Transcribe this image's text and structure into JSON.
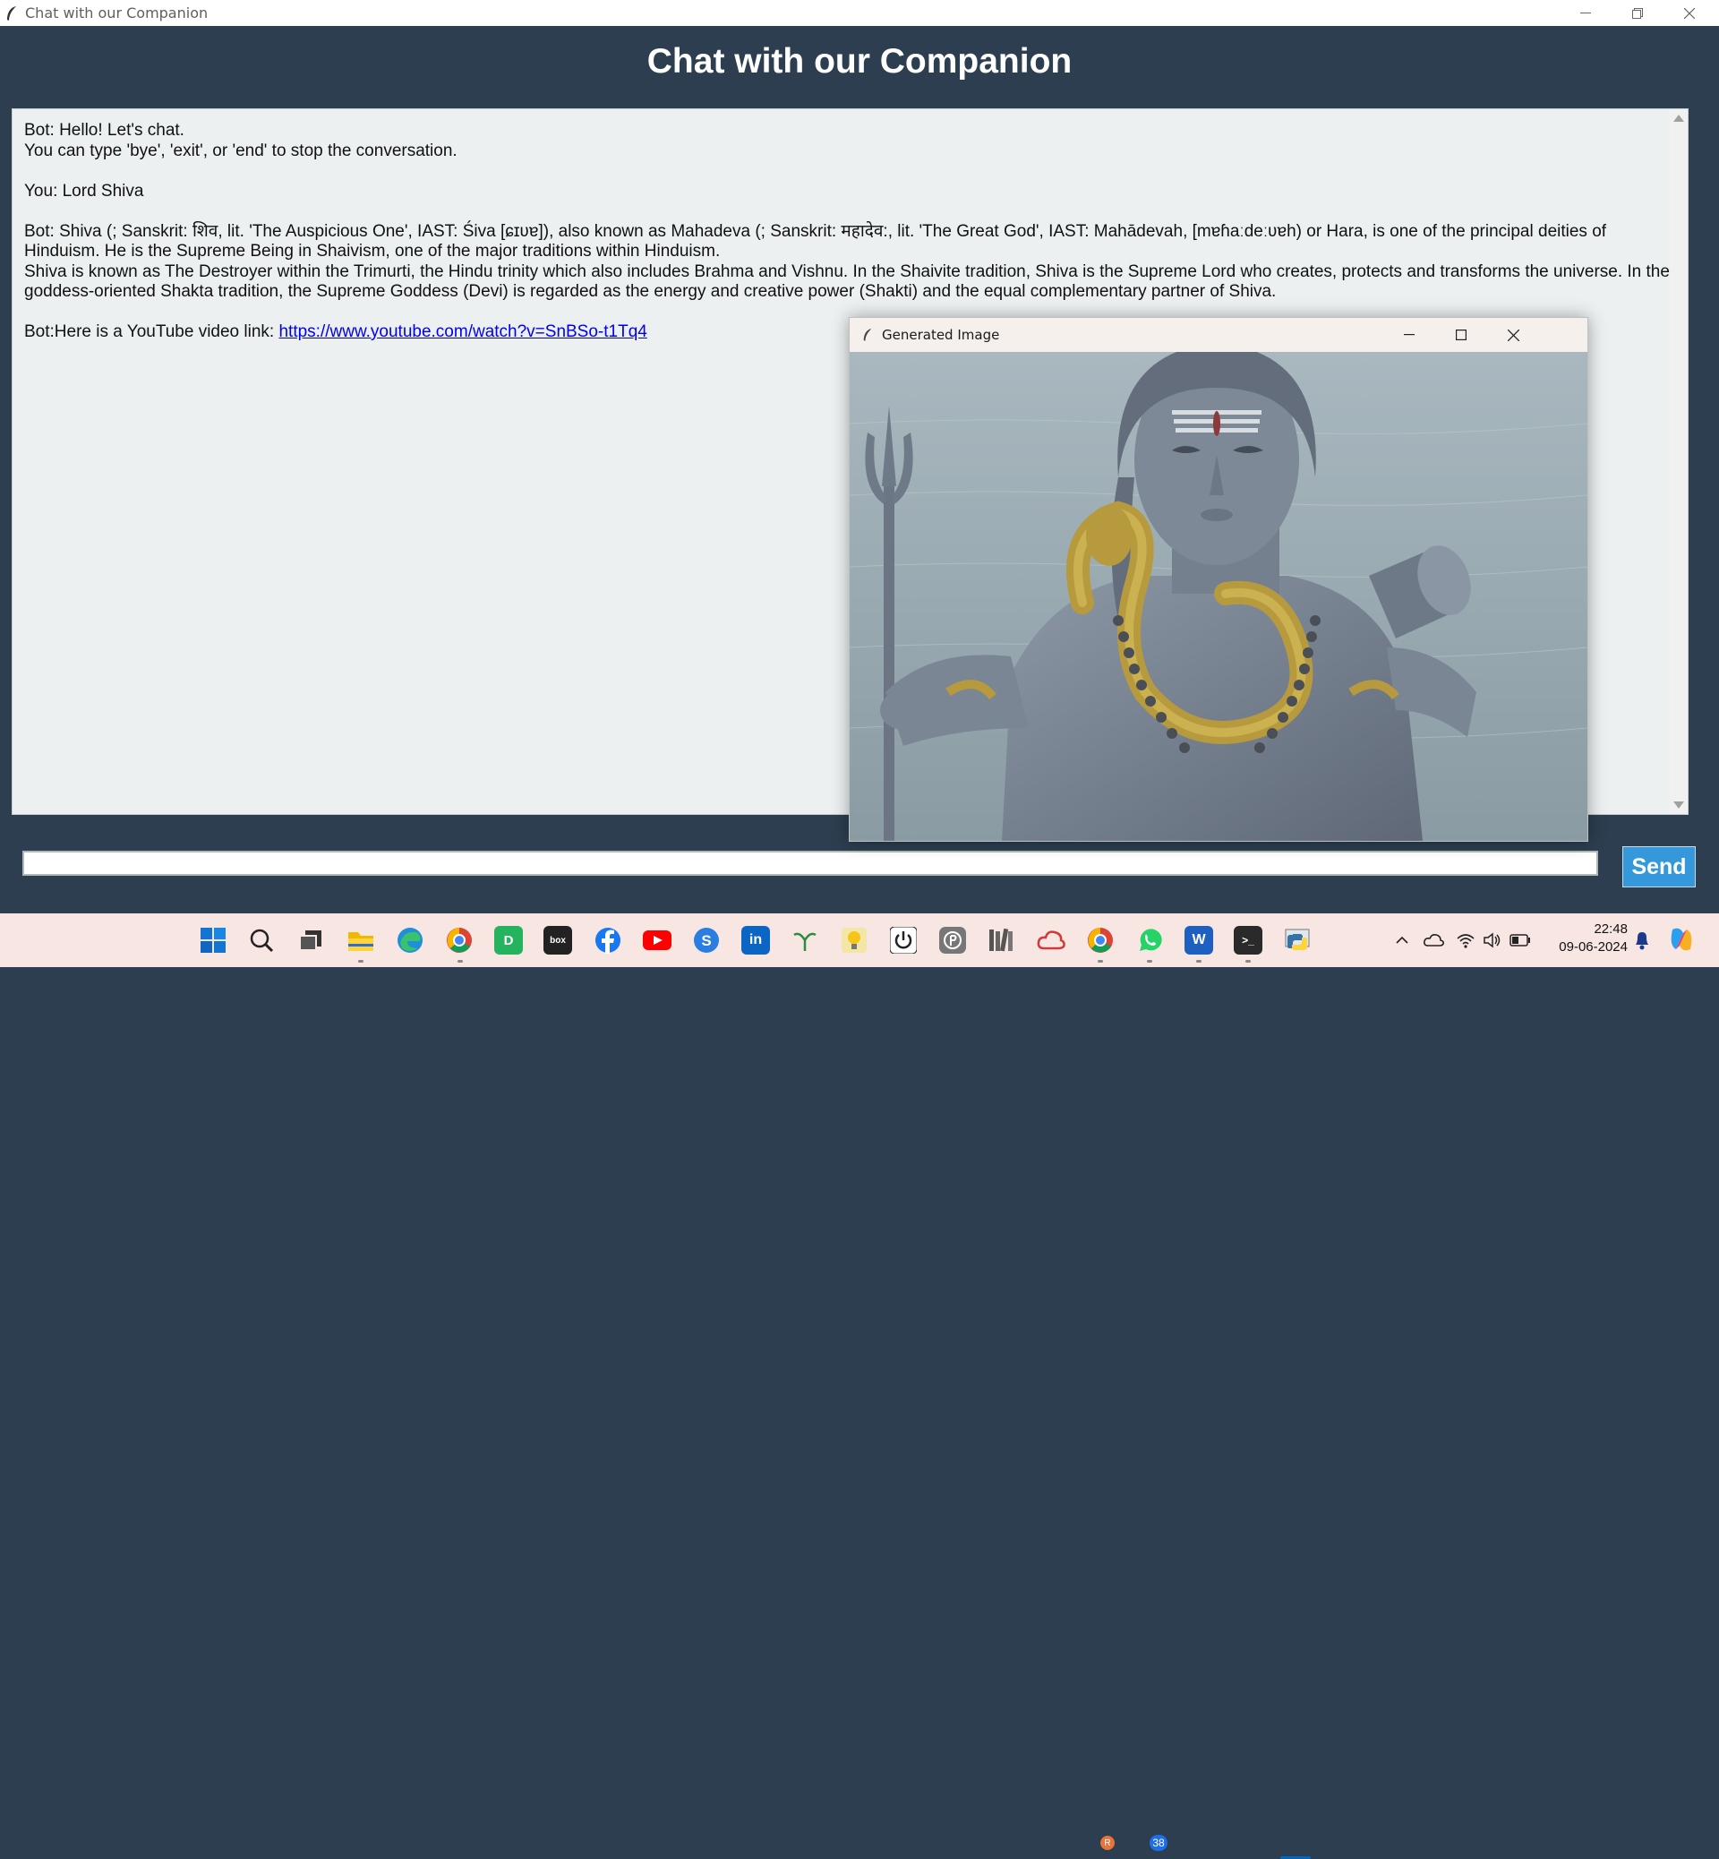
{
  "window": {
    "title": "Chat with our Companion"
  },
  "header": {
    "title": "Chat with our Companion"
  },
  "chat": {
    "greeting": "Bot: Hello! Let's chat.",
    "instructions": "You can type 'bye', 'exit', or 'end' to stop the conversation.",
    "user_message": "You: Lord Shiva",
    "bot_answer_1": "Bot: Shiva (; Sanskrit: शिव, lit. 'The Auspicious One', IAST: Śiva [ɕɪʋɐ]), also known as Mahadeva (; Sanskrit: महादेव:, lit. 'The Great God', IAST: Mahādevah, [mɐɦaːdeːʋɐh) or Hara, is one of the principal deities of Hinduism. He is the Supreme Being in Shaivism, one of the major traditions within Hinduism.",
    "bot_answer_2": "Shiva is known as The Destroyer within the Trimurti, the Hindu trinity which also includes Brahma and Vishnu. In the Shaivite tradition, Shiva is the Supreme Lord who creates, protects and transforms the universe. In the goddess-oriented Shakta tradition, the Supreme Goddess (Devi) is regarded as the energy and creative power (Shakti) and the equal complementary partner of Shiva.",
    "video_prefix": "Bot:Here is a YouTube video link: ",
    "video_link": "https://www.youtube.com/watch?v=SnBSo-t1Tq4"
  },
  "input": {
    "value": "",
    "placeholder": ""
  },
  "send_button": {
    "label": "Send"
  },
  "popup": {
    "title": "Generated Image"
  },
  "taskbar": {
    "whatsapp_badge": "38",
    "chrome_badge": "R",
    "time": "22:48",
    "date": "09-06-2024"
  },
  "colors": {
    "app_bg": "#2c3e50",
    "chat_bg": "#ecf0f1",
    "send_button": "#3498db",
    "link": "#0000ee",
    "taskbar_bg": "#f8e6e3"
  },
  "icons": [
    "feather-icon",
    "minimize-icon",
    "maximize-icon",
    "close-icon",
    "windows-start-icon",
    "search-icon",
    "task-view-icon",
    "file-explorer-icon",
    "edge-icon",
    "chrome-icon",
    "facebook-icon",
    "youtube-icon",
    "linkedin-icon",
    "whatsapp-icon",
    "word-icon",
    "terminal-icon",
    "python-icon",
    "wifi-icon",
    "volume-icon",
    "battery-icon",
    "notification-bell-icon",
    "copilot-icon"
  ]
}
